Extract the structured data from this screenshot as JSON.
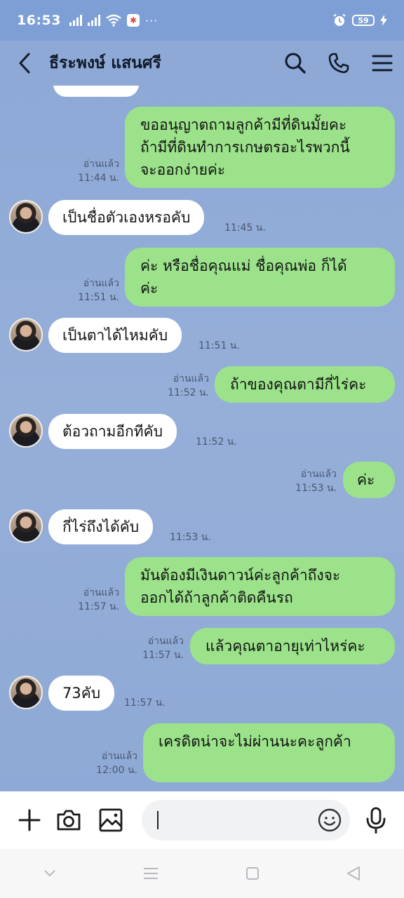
{
  "status_bar": {
    "time": "16:53",
    "signal_label_1": "4G",
    "battery": "59",
    "more": "···"
  },
  "header": {
    "title": "ธีระพงษ์ แสนศรี"
  },
  "messages": [
    {
      "id": "m1",
      "direction": "out",
      "lines": [
        "ขออนุญาตถามลูกค้ามีที่ดินมั้ยคะ",
        "ถ้ามีที่ดินทำการเกษตรอะไรพวกนี้",
        "จะออกง่ายค่ะ"
      ],
      "read": "อ่านแล้ว",
      "time": "11:44 น."
    },
    {
      "id": "m2",
      "direction": "in",
      "lines": [
        "เป็นชื่อตัวเองหรอคับ"
      ],
      "time": "11:45 น."
    },
    {
      "id": "m3",
      "direction": "out",
      "lines": [
        "ค่ะ หรือชื่อคุณแม่ ชื่อคุณพ่อ  ก็ได้",
        "ค่ะ"
      ],
      "read": "อ่านแล้ว",
      "time": "11:51 น."
    },
    {
      "id": "m4",
      "direction": "in",
      "lines": [
        "เป็นตาได้ไหมคับ"
      ],
      "time": "11:51 น."
    },
    {
      "id": "m5",
      "direction": "out",
      "lines": [
        "ถ้าของคุณตามีกี่ไร่คะ"
      ],
      "read": "อ่านแล้ว",
      "time": "11:52 น."
    },
    {
      "id": "m6",
      "direction": "in",
      "lines": [
        "ต้อวถามอีกทีคับ"
      ],
      "time": "11:52 น."
    },
    {
      "id": "m7",
      "direction": "out",
      "lines": [
        "ค่ะ"
      ],
      "read": "อ่านแล้ว",
      "time": "11:53 น."
    },
    {
      "id": "m8",
      "direction": "in",
      "lines": [
        "กี่ไร่ถึงได้คับ"
      ],
      "time": "11:53 น."
    },
    {
      "id": "m9",
      "direction": "out",
      "lines": [
        "มันต้องมีเงินดาวน์ค่ะลูกค้าถึงจะ",
        "ออกได้ถ้าลูกค้าติดคืนรถ"
      ],
      "read": "อ่านแล้ว",
      "time": "11:57 น."
    },
    {
      "id": "m10",
      "direction": "out",
      "lines": [
        "แล้วคุณตาอายุเท่าไหร่คะ"
      ],
      "read": "อ่านแล้ว",
      "time": "11:57 น."
    },
    {
      "id": "m11",
      "direction": "in",
      "lines": [
        "73คับ"
      ],
      "time": "11:57 น."
    },
    {
      "id": "m12",
      "direction": "out",
      "lines": [
        "เครดิตน่าจะไม่ผ่านนะคะลูกค้า"
      ],
      "read": "อ่านแล้ว",
      "time": "12:00 น."
    }
  ],
  "input": {
    "placeholder": ""
  },
  "colors": {
    "chat_bg": "#8ea9d6",
    "outgoing_bubble": "#9be28a",
    "incoming_bubble": "#ffffff"
  }
}
